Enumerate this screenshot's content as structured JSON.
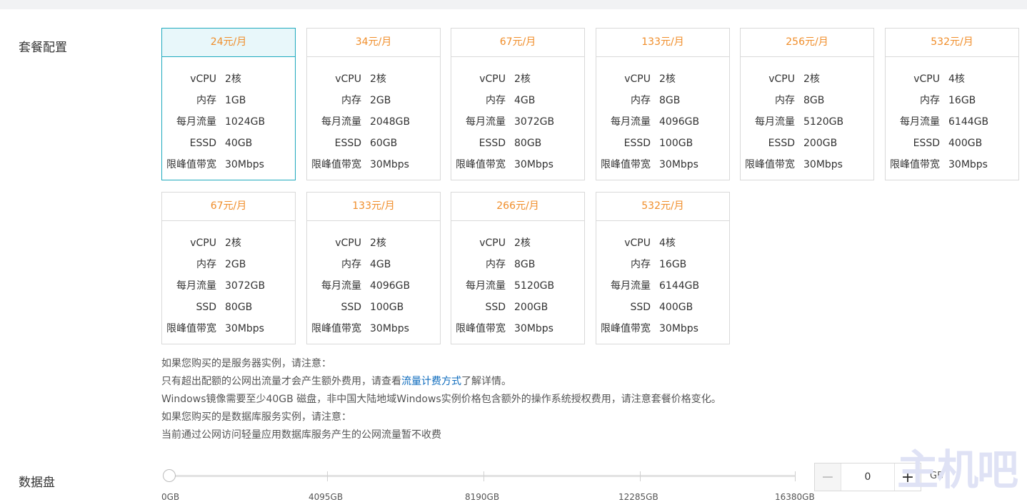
{
  "section_labels": {
    "package": "套餐配置",
    "data_disk": "数据盘"
  },
  "plans": [
    {
      "price": "24元/月",
      "specs": [
        {
          "k": "vCPU",
          "v": "2核"
        },
        {
          "k": "内存",
          "v": "1GB"
        },
        {
          "k": "每月流量",
          "v": "1024GB"
        },
        {
          "k": "ESSD",
          "v": "40GB"
        },
        {
          "k": "限峰值带宽",
          "v": "30Mbps"
        }
      ]
    },
    {
      "price": "34元/月",
      "specs": [
        {
          "k": "vCPU",
          "v": "2核"
        },
        {
          "k": "内存",
          "v": "2GB"
        },
        {
          "k": "每月流量",
          "v": "2048GB"
        },
        {
          "k": "ESSD",
          "v": "60GB"
        },
        {
          "k": "限峰值带宽",
          "v": "30Mbps"
        }
      ]
    },
    {
      "price": "67元/月",
      "specs": [
        {
          "k": "vCPU",
          "v": "2核"
        },
        {
          "k": "内存",
          "v": "4GB"
        },
        {
          "k": "每月流量",
          "v": "3072GB"
        },
        {
          "k": "ESSD",
          "v": "80GB"
        },
        {
          "k": "限峰值带宽",
          "v": "30Mbps"
        }
      ]
    },
    {
      "price": "133元/月",
      "specs": [
        {
          "k": "vCPU",
          "v": "2核"
        },
        {
          "k": "内存",
          "v": "8GB"
        },
        {
          "k": "每月流量",
          "v": "4096GB"
        },
        {
          "k": "ESSD",
          "v": "100GB"
        },
        {
          "k": "限峰值带宽",
          "v": "30Mbps"
        }
      ]
    },
    {
      "price": "256元/月",
      "specs": [
        {
          "k": "vCPU",
          "v": "2核"
        },
        {
          "k": "内存",
          "v": "8GB"
        },
        {
          "k": "每月流量",
          "v": "5120GB"
        },
        {
          "k": "ESSD",
          "v": "200GB"
        },
        {
          "k": "限峰值带宽",
          "v": "30Mbps"
        }
      ]
    },
    {
      "price": "532元/月",
      "specs": [
        {
          "k": "vCPU",
          "v": "4核"
        },
        {
          "k": "内存",
          "v": "16GB"
        },
        {
          "k": "每月流量",
          "v": "6144GB"
        },
        {
          "k": "ESSD",
          "v": "400GB"
        },
        {
          "k": "限峰值带宽",
          "v": "30Mbps"
        }
      ]
    },
    {
      "price": "67元/月",
      "specs": [
        {
          "k": "vCPU",
          "v": "2核"
        },
        {
          "k": "内存",
          "v": "2GB"
        },
        {
          "k": "每月流量",
          "v": "3072GB"
        },
        {
          "k": "SSD",
          "v": "80GB"
        },
        {
          "k": "限峰值带宽",
          "v": "30Mbps"
        }
      ]
    },
    {
      "price": "133元/月",
      "specs": [
        {
          "k": "vCPU",
          "v": "2核"
        },
        {
          "k": "内存",
          "v": "4GB"
        },
        {
          "k": "每月流量",
          "v": "4096GB"
        },
        {
          "k": "SSD",
          "v": "100GB"
        },
        {
          "k": "限峰值带宽",
          "v": "30Mbps"
        }
      ]
    },
    {
      "price": "266元/月",
      "specs": [
        {
          "k": "vCPU",
          "v": "2核"
        },
        {
          "k": "内存",
          "v": "8GB"
        },
        {
          "k": "每月流量",
          "v": "5120GB"
        },
        {
          "k": "SSD",
          "v": "200GB"
        },
        {
          "k": "限峰值带宽",
          "v": "30Mbps"
        }
      ]
    },
    {
      "price": "532元/月",
      "specs": [
        {
          "k": "vCPU",
          "v": "4核"
        },
        {
          "k": "内存",
          "v": "16GB"
        },
        {
          "k": "每月流量",
          "v": "6144GB"
        },
        {
          "k": "SSD",
          "v": "400GB"
        },
        {
          "k": "限峰值带宽",
          "v": "30Mbps"
        }
      ]
    }
  ],
  "notes": {
    "line1": "如果您购买的是服务器实例，请注意：",
    "line2_prefix": "只有超出配额的公网出流量才会产生额外费用，请查看",
    "line2_link": "流量计费方式",
    "line2_suffix": "了解详情。",
    "line3": "Windows镜像需要至少40GB 磁盘，非中国大陆地域Windows实例价格包含额外的操作系统授权费用，请注意套餐价格变化。",
    "line4": "如果您购买的是数据库服务实例，请注意：",
    "line5": "当前通过公网访问轻量应用数据库服务产生的公网流量暂不收费"
  },
  "disk": {
    "tick_labels": [
      "0GB",
      "4095GB",
      "8190GB",
      "12285GB",
      "16380GB"
    ],
    "value": "0",
    "unit": "GB",
    "minus_label": "−",
    "plus_label": "+"
  },
  "watermark": "主机吧"
}
